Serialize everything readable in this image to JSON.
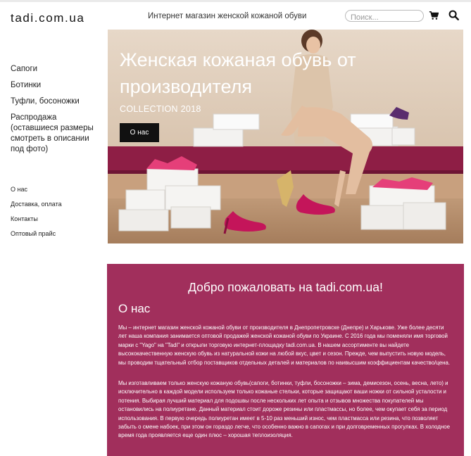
{
  "header": {
    "logo": "tadi.com.ua",
    "tagline": "Интернет магазин женской кожаной обуви",
    "search_placeholder": "Поиск...",
    "cart_icon": "shopping-cart-icon",
    "search_icon": "magnifier-icon"
  },
  "sidebar": {
    "categories": [
      {
        "label": "Сапоги"
      },
      {
        "label": "Ботинки"
      },
      {
        "label": "Туфли, босоножки"
      },
      {
        "label": "Распродажа (оставшиеся размеры смотреть в описании под фото)"
      }
    ],
    "info_links": [
      {
        "label": "О нас"
      },
      {
        "label": "Доставка, оплата"
      },
      {
        "label": "Контакты"
      },
      {
        "label": "Оптовый прайс"
      }
    ]
  },
  "hero": {
    "title": "Женская кожаная обувь от производителя",
    "subtitle": "COLLECTION 2018",
    "button_label": "О нас"
  },
  "welcome": {
    "heading": "Добро пожаловать на tadi.com.ua!",
    "subheading": "О нас",
    "paragraph1": "Мы – интернет магазин женской кожаной обуви от производителя в Днепропетровске (Днепре) и Харькове. Уже более десяти лет наша компания занимается оптовой продажей женской кожаной обуви по Украине. С 2016 года мы поменяли имя торговой марки с \"Yago\" на \"Tadi\" и открыли торговую интернет-площадку tadi.com.ua. В нашем ассортименте вы найдете высококачественную женскую обувь из натуральной кожи на любой вкус, цвет и сезон. Прежде, чем выпустить новую модель, мы проводим тщательный отбор поставщиков отдельных деталей и материалов по наивысшим коэффициентам качество/цена.",
    "paragraph2": "Мы изготавливаем только женскую кожаную обувь(сапоги, ботинки, туфли, босоножки – зима, демисезон, осень, весна, лето) и исключительно в каждой модели используем только кожаные стельки, которые защищают ваши ножки от сильной усталости и потения. Выбирая лучший материал для подошвы после нескольких лет опыта и отзывов множества покупателей мы остановились на полиуретане. Данный материал стоит дороже резины или пластмассы, но более, чем окупает себя за период использования. В первую очередь полиуретан имеет в 5-10 раз меньший износ, чем пластмасса или резина, что позволяет забыть о смене набоек, при этом он гораздо легче, что особенно важно в сапогах и при долговременных прогулках. В холодное время года проявляется еще один плюс – хорошая теплоизоляция."
  },
  "colors": {
    "welcome_bg": "#a12f5c",
    "hero_button_bg": "#111111",
    "bench": "#8e1e45"
  }
}
